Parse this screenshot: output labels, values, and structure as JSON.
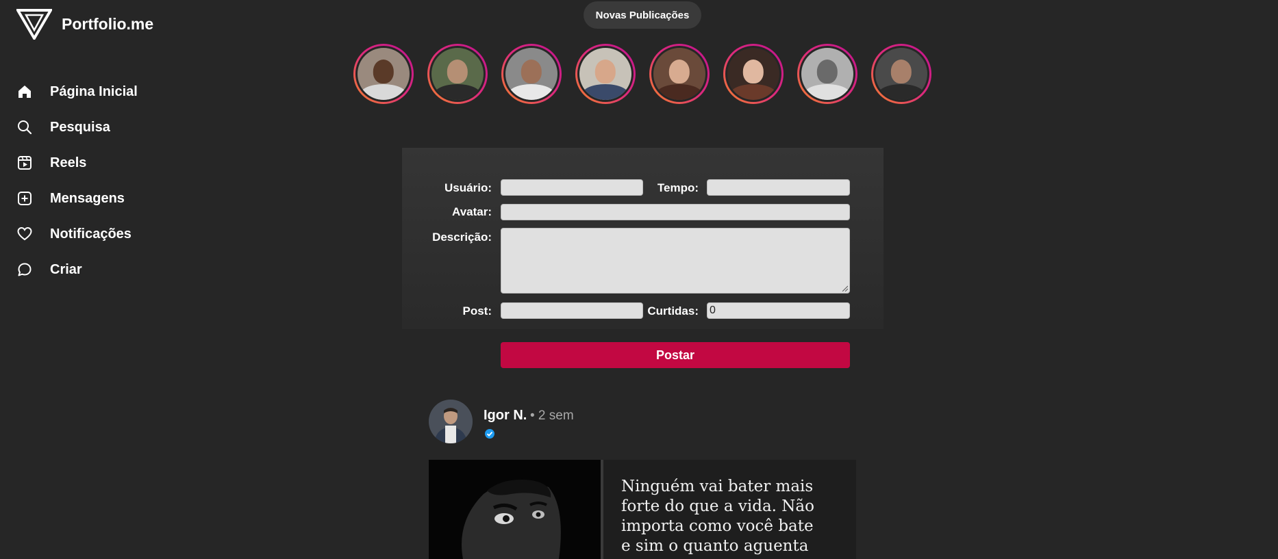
{
  "brand": {
    "name": "Portfolio.me"
  },
  "sidebar": {
    "items": [
      {
        "label": "Página Inicial",
        "icon": "home-icon"
      },
      {
        "label": "Pesquisa",
        "icon": "search-icon"
      },
      {
        "label": "Reels",
        "icon": "reels-icon"
      },
      {
        "label": "Mensagens",
        "icon": "plus-square-icon"
      },
      {
        "label": "Notificações",
        "icon": "heart-icon"
      },
      {
        "label": "Criar",
        "icon": "chat-bubble-icon"
      }
    ]
  },
  "header": {
    "new_posts_label": "Novas Publicações"
  },
  "stories": {
    "count": 8
  },
  "form": {
    "usuario_label": "Usuário:",
    "tempo_label": "Tempo:",
    "avatar_label": "Avatar:",
    "descricao_label": "Descrição:",
    "post_label": "Post:",
    "curtidas_label": "Curtidas:",
    "usuario_value": "",
    "tempo_value": "",
    "avatar_value": "",
    "descricao_value": "",
    "post_value": "",
    "curtidas_value": "0",
    "submit_label": "Postar"
  },
  "feed": {
    "post": {
      "user": "Igor N.",
      "time": "• 2 sem",
      "verified": true,
      "quote": "Ninguém vai bater mais forte do que a vida. Não importa como você bate e sim o quanto aguenta"
    }
  },
  "colors": {
    "background": "#262626",
    "accent": "#c20842",
    "verified": "#1d9bf0"
  }
}
